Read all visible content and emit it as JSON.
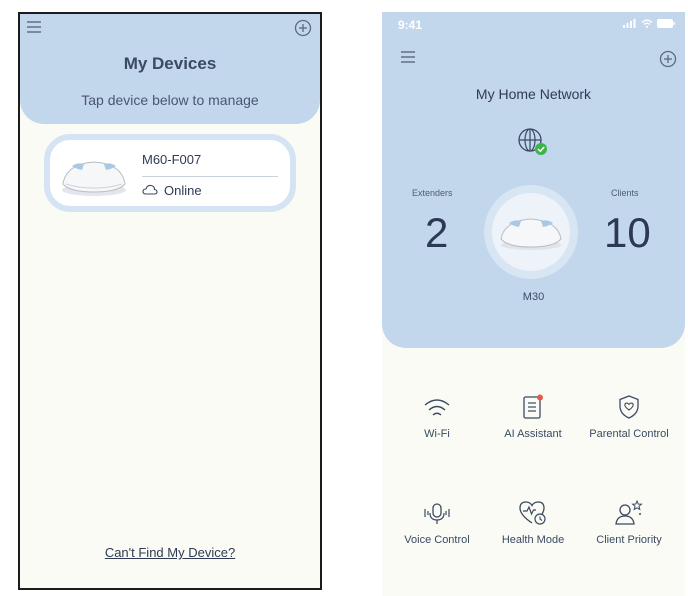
{
  "left": {
    "title": "My Devices",
    "subtitle": "Tap device below to manage",
    "device": {
      "name": "M60-F007",
      "status": "Online"
    },
    "link": "Can't Find My Device?"
  },
  "right": {
    "status_bar": {
      "time": "9:41"
    },
    "network_title": "My Home Network",
    "extenders": {
      "label": "Extenders",
      "value": "2"
    },
    "clients": {
      "label": "Clients",
      "value": "10"
    },
    "router_name": "M30",
    "tiles": [
      {
        "label": "Wi-Fi",
        "icon": "wifi-icon"
      },
      {
        "label": "AI Assistant",
        "icon": "ai-assistant-icon"
      },
      {
        "label": "Parental Control",
        "icon": "parental-control-icon"
      },
      {
        "label": "Voice Control",
        "icon": "voice-control-icon"
      },
      {
        "label": "Health Mode",
        "icon": "health-mode-icon"
      },
      {
        "label": "Client Priority",
        "icon": "client-priority-icon"
      }
    ]
  },
  "colors": {
    "header_blue": "#c2d6ec",
    "background": "#fbfbf5",
    "status_ok": "#3cb44b",
    "badge_red": "#e05a4f"
  }
}
